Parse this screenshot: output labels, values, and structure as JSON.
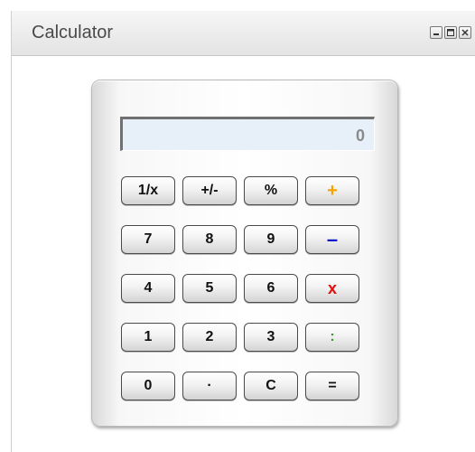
{
  "window": {
    "title": "Calculator",
    "controls": [
      {
        "name": "minimize-button",
        "icon": "minimize-icon"
      },
      {
        "name": "maximize-button",
        "icon": "maximize-icon"
      },
      {
        "name": "close-button",
        "icon": "close-icon"
      }
    ]
  },
  "calculator": {
    "display_value": "0",
    "keys": [
      {
        "label": "1/x",
        "name": "key-reciprocal"
      },
      {
        "label": "+/-",
        "name": "key-negate"
      },
      {
        "label": "%",
        "name": "key-percent"
      },
      {
        "label": "+",
        "name": "key-add",
        "color": "#f5a300"
      },
      {
        "label": "7",
        "name": "key-7"
      },
      {
        "label": "8",
        "name": "key-8"
      },
      {
        "label": "9",
        "name": "key-9"
      },
      {
        "label": "–",
        "name": "key-subtract",
        "color": "#1010c8"
      },
      {
        "label": "4",
        "name": "key-4"
      },
      {
        "label": "5",
        "name": "key-5"
      },
      {
        "label": "6",
        "name": "key-6"
      },
      {
        "label": "x",
        "name": "key-multiply",
        "color": "#e01010"
      },
      {
        "label": "1",
        "name": "key-1"
      },
      {
        "label": "2",
        "name": "key-2"
      },
      {
        "label": "3",
        "name": "key-3"
      },
      {
        "label": ":",
        "name": "key-divide",
        "color": "#3a9a2a"
      },
      {
        "label": "0",
        "name": "key-0"
      },
      {
        "label": "·",
        "name": "key-decimal"
      },
      {
        "label": "C",
        "name": "key-clear"
      },
      {
        "label": "=",
        "name": "key-equals"
      }
    ]
  }
}
